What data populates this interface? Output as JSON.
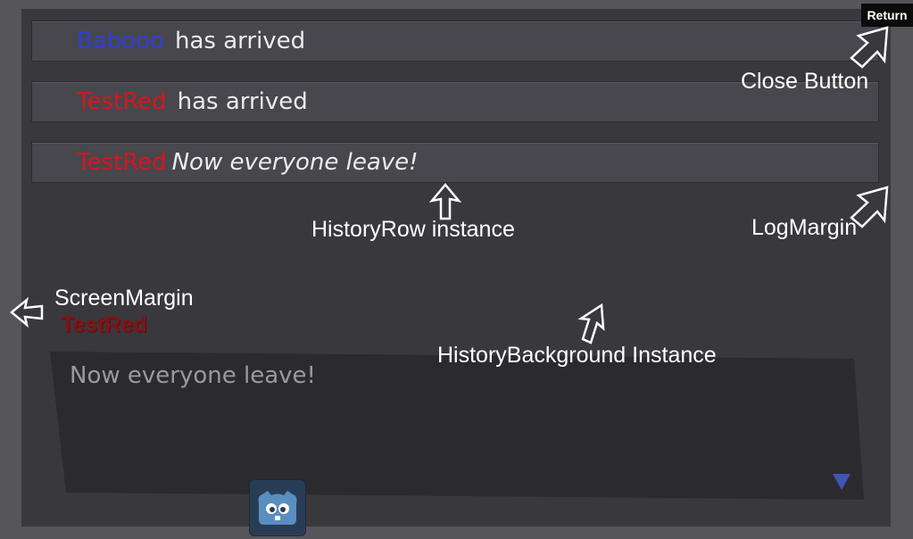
{
  "history": {
    "rows": [
      {
        "name": "Babooo",
        "name_color": "blue",
        "message": "has arrived"
      },
      {
        "name": "TestRed",
        "name_color": "red",
        "message": "has arrived"
      },
      {
        "name": "TestRed",
        "name_color": "red",
        "message": "Now everyone leave!"
      }
    ]
  },
  "return_button": {
    "label": "Return"
  },
  "annotations": {
    "close_button": "Close Button",
    "history_row": "HistoryRow instance",
    "log_margin": "LogMargin",
    "screen_margin": "ScreenMargin",
    "history_background": "HistoryBackground Instance"
  },
  "dialog": {
    "speaker": "TestRed",
    "text": "Now everyone leave!"
  },
  "icons": {
    "next": "triangle-down-icon",
    "app": "godot-icon"
  },
  "colors": {
    "name_red": "#d7151d",
    "name_blue": "#2d3fd8",
    "next_indicator": "#3f55b8"
  }
}
